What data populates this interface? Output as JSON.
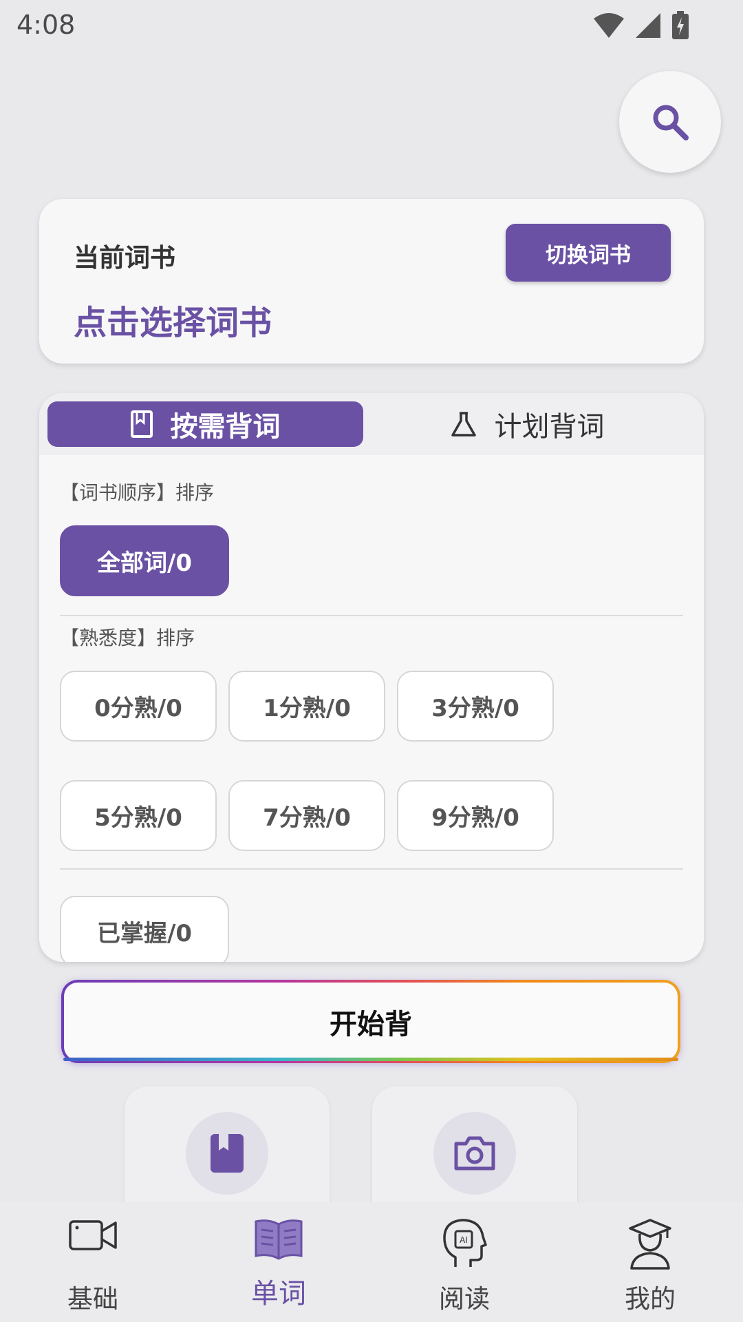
{
  "status_bar": {
    "time": "4:08"
  },
  "book_card": {
    "label": "当前词书",
    "book_name": "点击选择词书",
    "switch_button": "切换词书"
  },
  "mode_tabs": [
    {
      "label": "按需背词",
      "icon": "book-icon",
      "selected": true
    },
    {
      "label": "计划背词",
      "icon": "flask-icon",
      "selected": false
    }
  ],
  "sections": {
    "order_title": "【词书顺序】排序",
    "order_chips": [
      "全部词/0"
    ],
    "familiarity_title": "【熟悉度】排序",
    "familiarity_chips": [
      "0分熟/0",
      "1分熟/0",
      "3分熟/0",
      "5分熟/0",
      "7分熟/0",
      "9分熟/0"
    ],
    "mastered_chip": "已掌握/0"
  },
  "start_button": "开始背",
  "tool_cards": [
    {
      "icon": "bookmark-book-icon"
    },
    {
      "icon": "camera-icon"
    }
  ],
  "bottom_nav": [
    {
      "label": "基础",
      "icon": "video-camera-icon",
      "active": false
    },
    {
      "label": "单词",
      "icon": "open-book-icon",
      "active": true
    },
    {
      "label": "阅读",
      "icon": "ai-head-icon",
      "active": false
    },
    {
      "label": "我的",
      "icon": "graduate-user-icon",
      "active": false
    }
  ],
  "colors": {
    "accent": "#6a51a4",
    "background": "#e9e9ec",
    "card": "#f7f7f8"
  }
}
